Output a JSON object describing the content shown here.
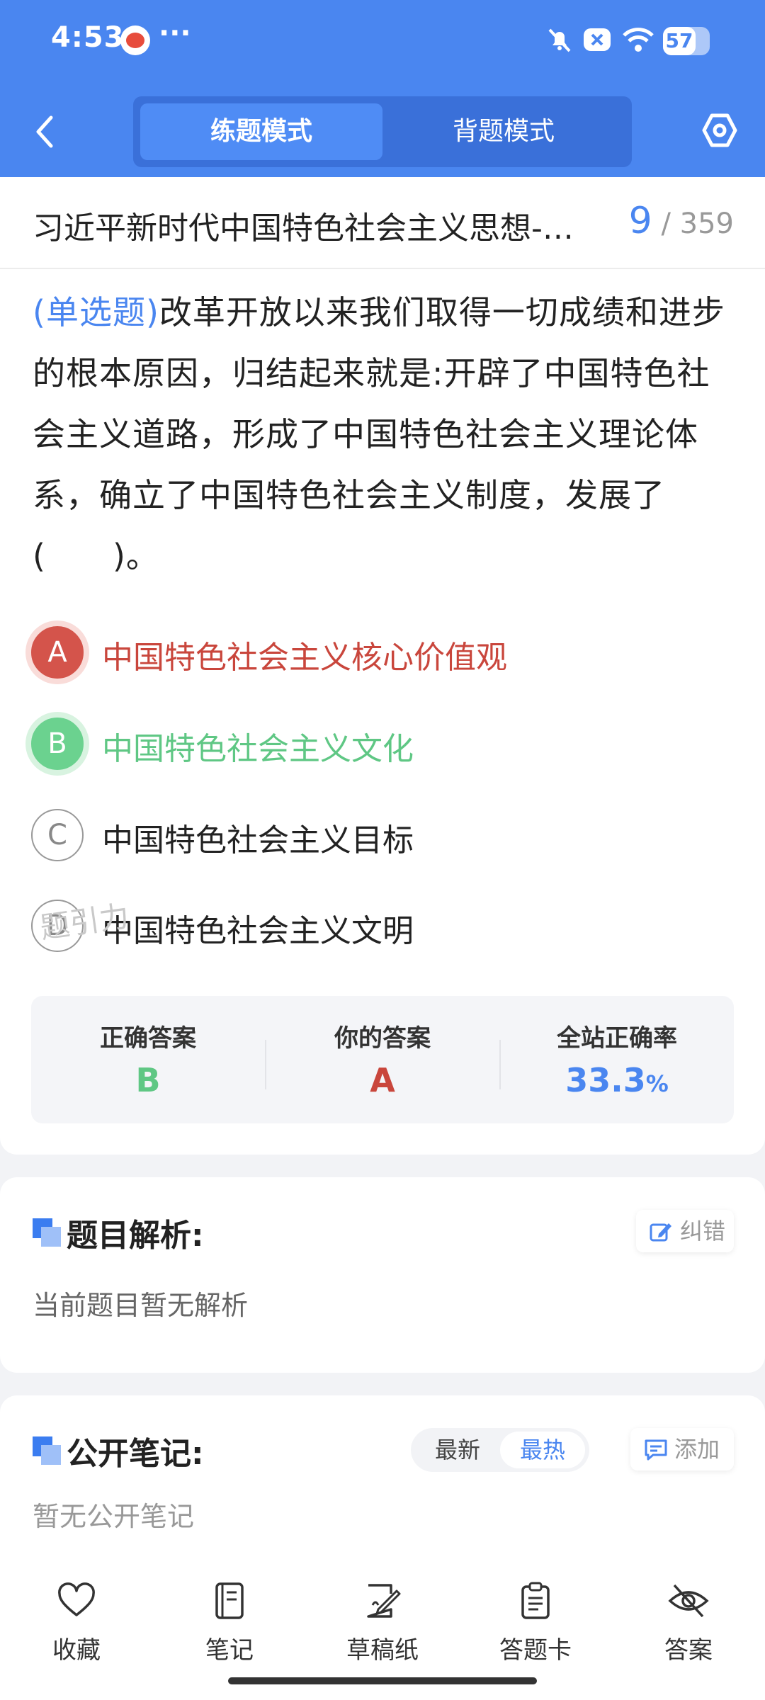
{
  "status_bar": {
    "time": "4:53",
    "more": "···",
    "battery": "57"
  },
  "header": {
    "modes": [
      "练题模式",
      "背题模式"
    ],
    "active_mode": 0
  },
  "question": {
    "title": "习近平新时代中国特色社会主义思想-…",
    "index": "9",
    "total": "/ 359",
    "type": "(单选题)",
    "text": "改革开放以来我们取得一切成绩和进步的根本原因，归结起来就是:开辟了中国特色社会主义道路，形成了中国特色社会主义理论体系，确立了中国特色社会主义制度，发展了(　　)。"
  },
  "options": [
    {
      "letter": "A",
      "text": "中国特色社会主义核心价值观",
      "state": "wrong"
    },
    {
      "letter": "B",
      "text": "中国特色社会主义文化",
      "state": "correct"
    },
    {
      "letter": "C",
      "text": "中国特色社会主义目标",
      "state": "none"
    },
    {
      "letter": "D",
      "text": "中国特色社会主义文明",
      "state": "none"
    }
  ],
  "watermark": "题引力",
  "stats": {
    "correct_label": "正确答案",
    "correct_value": "B",
    "yours_label": "你的答案",
    "yours_value": "A",
    "rate_label": "全站正确率",
    "rate_value": "33.3",
    "rate_unit": "%"
  },
  "analysis": {
    "title": "题目解析:",
    "report_label": "纠错",
    "body": "当前题目暂无解析"
  },
  "notes": {
    "title": "公开笔记:",
    "sort": [
      "最新",
      "最热"
    ],
    "add_label": "添加",
    "body": "暂无公开笔记"
  },
  "toolbar": [
    "收藏",
    "笔记",
    "草稿纸",
    "答题卡",
    "答案"
  ],
  "colors": {
    "primary": "#4a86f0",
    "wrong": "#d4544b",
    "correct": "#6bd28f"
  }
}
